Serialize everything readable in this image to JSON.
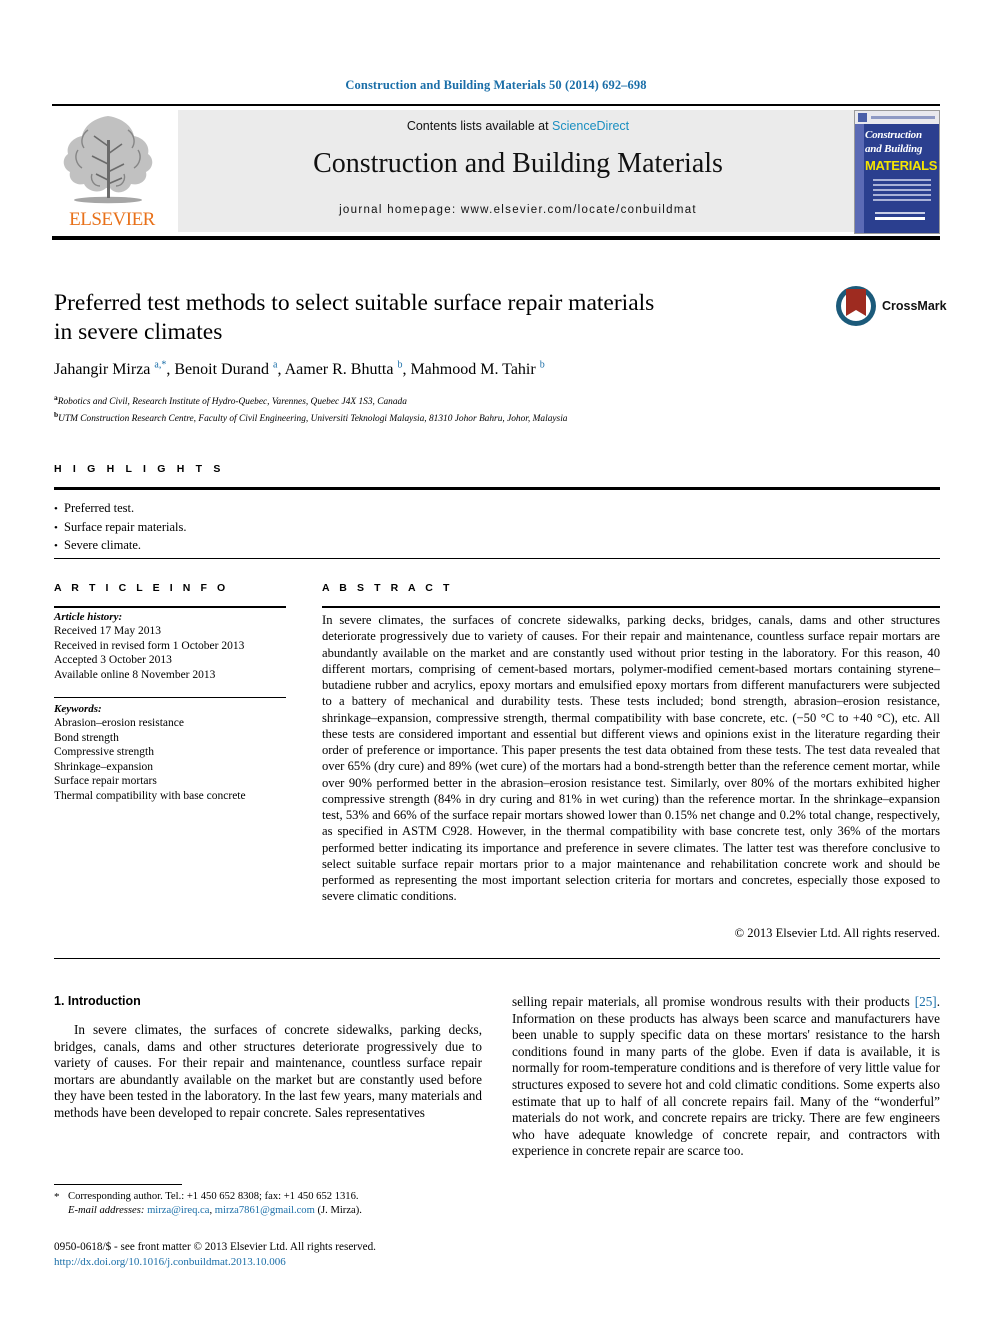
{
  "running_head": "Construction and Building Materials 50 (2014) 692–698",
  "header": {
    "contents_prefix": "Contents lists available at ",
    "sciencedirect": "ScienceDirect",
    "journal_title": "Construction and Building Materials",
    "journal_homepage": "journal homepage: www.elsevier.com/locate/conbuildmat",
    "publisher": "ELSEVIER",
    "cover": {
      "line1": "Construction",
      "line2": "and Building",
      "line3": "MATERIALS"
    },
    "accent_blue": "#1a8fc1",
    "elsevier_orange": "#e8711a"
  },
  "article": {
    "title_line1": "Preferred test methods to select suitable surface repair materials",
    "title_line2": "in severe climates",
    "authors_html": "Jahangir Mirza <sup>a,*</sup>, Benoit Durand <sup>a</sup>, Aamer R. Bhutta <sup>b</sup>, Mahmood M. Tahir <sup>b</sup>",
    "affiliation_a": "Robotics and Civil, Research Institute of Hydro-Quebec, Varennes, Quebec J4X 1S3, Canada",
    "affiliation_b": "UTM Construction Research Centre, Faculty of Civil Engineering, Universiti Teknologi Malaysia, 81310 Johor Bahru, Johor, Malaysia",
    "crossmark_label": "CrossMark"
  },
  "highlights": {
    "heading": "H I G H L I G H T S",
    "items": [
      "Preferred test.",
      "Surface repair materials.",
      "Severe climate."
    ]
  },
  "article_info": {
    "heading": "A R T I C L E   I N F O",
    "history_label": "Article history:",
    "history": [
      "Received 17 May 2013",
      "Received in revised form 1 October 2013",
      "Accepted 3 October 2013",
      "Available online 8 November 2013"
    ],
    "keywords_label": "Keywords:",
    "keywords": [
      "Abrasion–erosion resistance",
      "Bond strength",
      "Compressive strength",
      "Shrinkage–expansion",
      "Surface repair mortars",
      "Thermal compatibility with base concrete"
    ]
  },
  "abstract": {
    "heading": "A B S T R A C T",
    "text": "In severe climates, the surfaces of concrete sidewalks, parking decks, bridges, canals, dams and other structures deteriorate progressively due to variety of causes. For their repair and maintenance, countless surface repair mortars are abundantly available on the market and are constantly used without prior testing in the laboratory. For this reason, 40 different mortars, comprising of cement-based mortars, polymer-modified cement-based mortars containing styrene–butadiene rubber and acrylics, epoxy mortars and emulsified epoxy mortars from different manufacturers were subjected to a battery of mechanical and durability tests. These tests included; bond strength, abrasion–erosion resistance, shrinkage–expansion, compressive strength, thermal compatibility with base concrete, etc. (−50 °C to +40 °C), etc. All these tests are considered important and essential but different views and opinions exist in the literature regarding their order of preference or importance. This paper presents the test data obtained from these tests. The test data revealed that over 65% (dry cure) and 89% (wet cure) of the mortars had a bond-strength better than the reference cement mortar, while over 90% performed better in the abrasion–erosion resistance test. Similarly, over 80% of the mortars exhibited higher compressive strength (84% in dry curing and 81% in wet curing) than the reference mortar. In the shrinkage–expansion test, 53% and 66% of the surface repair mortars showed lower than 0.15% net change and 0.2% total change, respectively, as specified in ASTM C928. However, in the thermal compatibility with base concrete test, only 36% of the mortars performed better indicating its importance and preference in severe climates. The latter test was therefore conclusive to select suitable surface repair mortars prior to a major maintenance and rehabilitation concrete work and should be performed as representing the most important selection criteria for mortars and concretes, especially those exposed to severe climatic conditions.",
    "copyright": "© 2013 Elsevier Ltd. All rights reserved."
  },
  "body": {
    "section_heading": "1. Introduction",
    "left_paragraph": "In severe climates, the surfaces of concrete sidewalks, parking decks, bridges, canals, dams and other structures deteriorate progressively due to variety of causes. For their repair and maintenance, countless surface repair mortars are abundantly available on the market but are constantly used before they have been tested in the laboratory. In the last few years, many materials and methods have been developed to repair concrete. Sales representatives",
    "right_paragraph_part1": "selling repair materials, all promise wondrous results with their products ",
    "right_reference": "[25]",
    "right_paragraph_part2": ". Information on these products has always been scarce and manufacturers have been unable to supply specific data on these mortars' resistance to the harsh conditions found in many parts of the globe. Even if data is available, it is normally for room-temperature conditions and is therefore of very little value for structures exposed to severe hot and cold climatic conditions. Some experts also estimate that up to half of all concrete repairs fail. Many of the “wonderful” materials do not work, and concrete repairs are tricky. There are few engineers who have adequate knowledge of concrete repair, and contractors with experience in concrete repair are scarce too."
  },
  "footnote": {
    "star": "*",
    "corresponding": "Corresponding author. Tel.: +1 450 652 8308; fax: +1 450 652 1316.",
    "email_label": "E-mail addresses:",
    "email1": "mirza@ireq.ca",
    "email_sep": ", ",
    "email2": "mirza7861@gmail.com",
    "email_suffix": " (J. Mirza)."
  },
  "footer": {
    "issn_line": "0950-0618/$ - see front matter © 2013 Elsevier Ltd. All rights reserved.",
    "doi": "http://dx.doi.org/10.1016/j.conbuildmat.2013.10.006"
  }
}
